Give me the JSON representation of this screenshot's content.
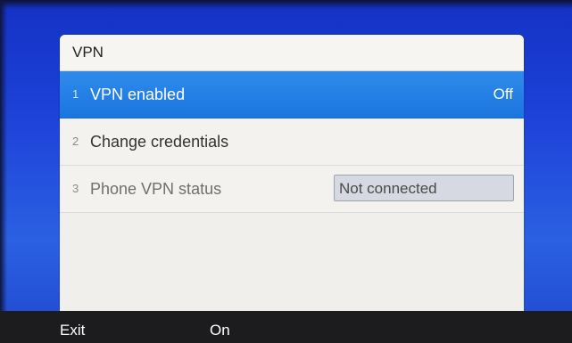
{
  "panel": {
    "title": "VPN"
  },
  "menu": {
    "items": [
      {
        "number": "1",
        "label": "VPN enabled",
        "value": "Off",
        "selected": true
      },
      {
        "number": "2",
        "label": "Change credentials",
        "selected": false
      },
      {
        "number": "3",
        "label": "Phone VPN status",
        "value": "Not connected",
        "selected": false
      }
    ]
  },
  "softkeys": {
    "exit_label": "Exit",
    "on_label": "On"
  },
  "colors": {
    "selection": "#1f7ee4",
    "background_blue": "#1d43d8",
    "softkey_bar": "#1c1c1e"
  }
}
